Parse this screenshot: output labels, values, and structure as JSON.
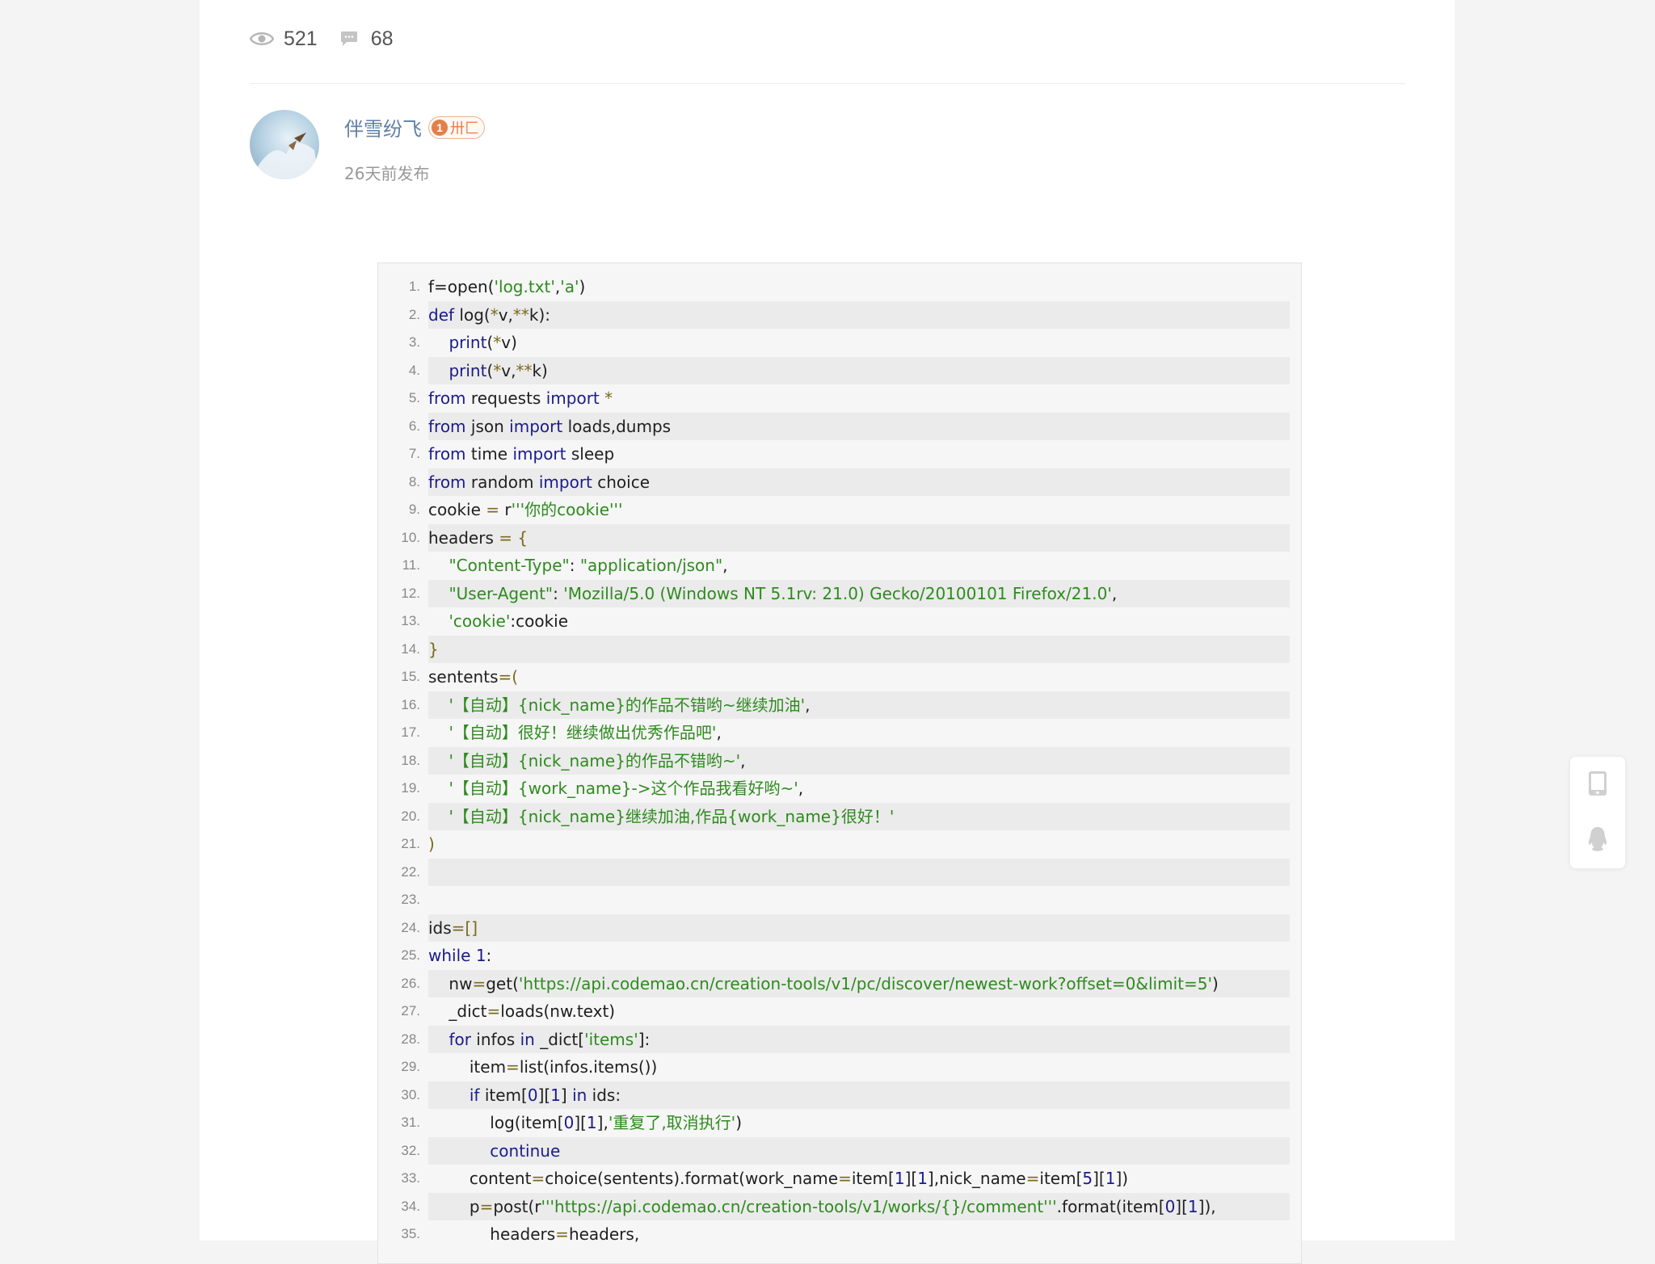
{
  "post": {
    "views": "521",
    "comments": "68"
  },
  "author": {
    "name": "伴雪纷飞",
    "level": "1",
    "level_label": "卅匚",
    "time": "26天前发布"
  },
  "icons": {
    "views": "eye-icon",
    "comments": "comment-icon",
    "mobile": "mobile-icon",
    "qq": "qq-icon"
  },
  "colors": {
    "keyword": "#1b1b8c",
    "string": "#2e8b1e",
    "link": "#5e7fa8",
    "badge": "#e27f4a"
  },
  "code": {
    "lines": [
      [
        [
          "f=open(",
          ""
        ],
        [
          "'log.txt'",
          "str"
        ],
        [
          ",",
          ""
        ],
        [
          "'a'",
          "str"
        ],
        [
          ")",
          ""
        ]
      ],
      [
        [
          "def ",
          "kw"
        ],
        [
          "log(",
          ""
        ],
        [
          "*",
          "op"
        ],
        [
          "v,",
          ""
        ],
        [
          "**",
          "op"
        ],
        [
          "k):",
          ""
        ]
      ],
      [
        [
          "    ",
          ""
        ],
        [
          "print",
          "kw"
        ],
        [
          "(",
          ""
        ],
        [
          "*",
          "op"
        ],
        [
          "v)",
          ""
        ]
      ],
      [
        [
          "    ",
          ""
        ],
        [
          "print",
          "kw"
        ],
        [
          "(",
          ""
        ],
        [
          "*",
          "op"
        ],
        [
          "v,",
          ""
        ],
        [
          "**",
          "op"
        ],
        [
          "k)",
          ""
        ]
      ],
      [
        [
          "from ",
          "kw"
        ],
        [
          "requests ",
          ""
        ],
        [
          "import ",
          "kw"
        ],
        [
          "*",
          "op"
        ]
      ],
      [
        [
          "from ",
          "kw"
        ],
        [
          "json ",
          ""
        ],
        [
          "import ",
          "kw"
        ],
        [
          "loads,dumps",
          ""
        ]
      ],
      [
        [
          "from ",
          "kw"
        ],
        [
          "time ",
          ""
        ],
        [
          "import ",
          "kw"
        ],
        [
          "sleep",
          ""
        ]
      ],
      [
        [
          "from ",
          "kw"
        ],
        [
          "random ",
          ""
        ],
        [
          "import ",
          "kw"
        ],
        [
          "choice",
          ""
        ]
      ],
      [
        [
          "cookie ",
          ""
        ],
        [
          "= ",
          "op"
        ],
        [
          "r",
          ""
        ],
        [
          "'''你的cookie'''",
          "str"
        ]
      ],
      [
        [
          "headers ",
          ""
        ],
        [
          "= {",
          "op"
        ]
      ],
      [
        [
          "    ",
          ""
        ],
        [
          "\"Content-Type\"",
          "str"
        ],
        [
          ": ",
          ""
        ],
        [
          "\"application/json\"",
          "str"
        ],
        [
          ",",
          ""
        ]
      ],
      [
        [
          "    ",
          ""
        ],
        [
          "\"User-Agent\"",
          "str"
        ],
        [
          ": ",
          ""
        ],
        [
          "'Mozilla/5.0 (Windows NT 5.1rv: 21.0) Gecko/20100101 Firefox/21.0'",
          "str"
        ],
        [
          ",",
          ""
        ]
      ],
      [
        [
          "    ",
          ""
        ],
        [
          "'cookie'",
          "str"
        ],
        [
          ":cookie",
          ""
        ]
      ],
      [
        [
          "}",
          "op"
        ]
      ],
      [
        [
          "sentents",
          ""
        ],
        [
          "=(",
          "op"
        ]
      ],
      [
        [
          "    ",
          ""
        ],
        [
          "'【自动】{nick_name}的作品不错哟~继续加油'",
          "str"
        ],
        [
          ",",
          ""
        ]
      ],
      [
        [
          "    ",
          ""
        ],
        [
          "'【自动】很好！继续做出优秀作品吧'",
          "str"
        ],
        [
          ",",
          ""
        ]
      ],
      [
        [
          "    ",
          ""
        ],
        [
          "'【自动】{nick_name}的作品不错哟~'",
          "str"
        ],
        [
          ",",
          ""
        ]
      ],
      [
        [
          "    ",
          ""
        ],
        [
          "'【自动】{work_name}->这个作品我看好哟~'",
          "str"
        ],
        [
          ",",
          ""
        ]
      ],
      [
        [
          "    ",
          ""
        ],
        [
          "'【自动】{nick_name}继续加油,作品{work_name}很好！'",
          "str"
        ]
      ],
      [
        [
          ")",
          "op"
        ]
      ],
      [],
      [],
      [
        [
          "ids",
          ""
        ],
        [
          "=[]",
          "op"
        ]
      ],
      [
        [
          "while ",
          "kw"
        ],
        [
          "1",
          "num"
        ],
        [
          ":",
          ""
        ]
      ],
      [
        [
          "    nw",
          ""
        ],
        [
          "=",
          "op"
        ],
        [
          "get(",
          ""
        ],
        [
          "'https://api.codemao.cn/creation-tools/v1/pc/discover/newest-work?offset=0&limit=5'",
          "str"
        ],
        [
          ")",
          ""
        ]
      ],
      [
        [
          "    _dict",
          ""
        ],
        [
          "=",
          "op"
        ],
        [
          "loads(nw.text)",
          ""
        ]
      ],
      [
        [
          "    ",
          ""
        ],
        [
          "for ",
          "kw"
        ],
        [
          "infos ",
          ""
        ],
        [
          "in ",
          "kw"
        ],
        [
          "_dict[",
          ""
        ],
        [
          "'items'",
          "str"
        ],
        [
          "]:",
          ""
        ]
      ],
      [
        [
          "        item",
          ""
        ],
        [
          "=",
          "op"
        ],
        [
          "list(infos.items())",
          ""
        ]
      ],
      [
        [
          "        ",
          ""
        ],
        [
          "if ",
          "kw"
        ],
        [
          "item[",
          ""
        ],
        [
          "0",
          "num"
        ],
        [
          "][",
          ""
        ],
        [
          "1",
          "num"
        ],
        [
          "] ",
          ""
        ],
        [
          "in ",
          "kw"
        ],
        [
          "ids:",
          ""
        ]
      ],
      [
        [
          "            log(item[",
          ""
        ],
        [
          "0",
          "num"
        ],
        [
          "][",
          ""
        ],
        [
          "1",
          "num"
        ],
        [
          "],",
          ""
        ],
        [
          "'重复了,取消执行'",
          "str"
        ],
        [
          ")",
          ""
        ]
      ],
      [
        [
          "            ",
          ""
        ],
        [
          "continue",
          "kw"
        ]
      ],
      [
        [
          "        content",
          ""
        ],
        [
          "=",
          "op"
        ],
        [
          "choice(sentents).format(work_name",
          ""
        ],
        [
          "=",
          "op"
        ],
        [
          "item[",
          ""
        ],
        [
          "1",
          "num"
        ],
        [
          "][",
          ""
        ],
        [
          "1",
          "num"
        ],
        [
          "],nick_name",
          ""
        ],
        [
          "=",
          "op"
        ],
        [
          "item[",
          ""
        ],
        [
          "5",
          "num"
        ],
        [
          "][",
          ""
        ],
        [
          "1",
          "num"
        ],
        [
          "])",
          ""
        ]
      ],
      [
        [
          "        p",
          ""
        ],
        [
          "=",
          "op"
        ],
        [
          "post(r",
          ""
        ],
        [
          "'''https://api.codemao.cn/creation-tools/v1/works/{}/comment'''",
          "str"
        ],
        [
          ".format(item[",
          ""
        ],
        [
          "0",
          "num"
        ],
        [
          "][",
          ""
        ],
        [
          "1",
          "num"
        ],
        [
          "]),",
          ""
        ]
      ],
      [
        [
          "            headers",
          ""
        ],
        [
          "=",
          "op"
        ],
        [
          "headers,",
          ""
        ]
      ]
    ]
  }
}
